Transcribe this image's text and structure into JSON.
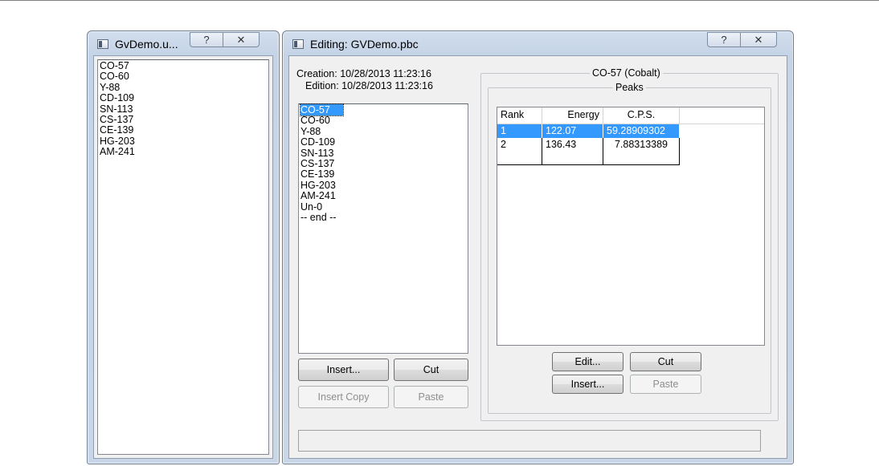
{
  "left_window": {
    "title": "GvDemo.u...",
    "help_glyph": "?",
    "close_glyph": "✕",
    "items": [
      "CO-57",
      "CO-60",
      "Y-88",
      "CD-109",
      "SN-113",
      "CS-137",
      "CE-139",
      "HG-203",
      "AM-241"
    ]
  },
  "main_window": {
    "title": "Editing: GVDemo.pbc",
    "help_glyph": "?",
    "close_glyph": "✕",
    "creation": "Creation: 10/28/2013  11:23:16",
    "edition": "Edition: 10/28/2013  11:23:16",
    "isotopes": [
      "CO-57",
      "CO-60",
      "Y-88",
      "CD-109",
      "SN-113",
      "CS-137",
      "CE-139",
      "HG-203",
      "AM-241",
      "Un-0",
      "-- end --"
    ],
    "selected_isotope_index": 0,
    "buttons": {
      "insert": "Insert...",
      "cut": "Cut",
      "insert_copy": "Insert Copy",
      "paste": "Paste"
    },
    "element_group_label": "CO-57 (Cobalt)",
    "peaks_group_label": "Peaks",
    "peaks_table": {
      "columns": [
        "Rank",
        "Energy",
        "C.P.S."
      ],
      "rows": [
        [
          "1",
          "122.07",
          "59.28909302"
        ],
        [
          "2",
          "136.43",
          "7.88313389"
        ]
      ],
      "selected_row": 0
    },
    "peak_buttons": {
      "edit": "Edit...",
      "cut": "Cut",
      "insert": "Insert...",
      "paste": "Paste"
    },
    "status_text": ""
  }
}
